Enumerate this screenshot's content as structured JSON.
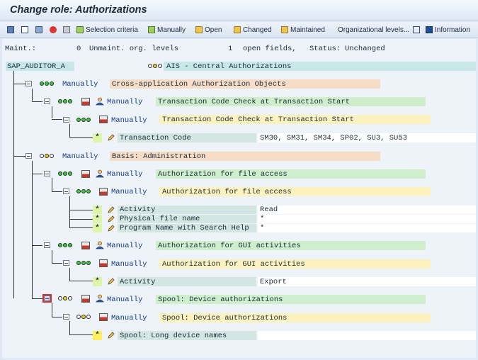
{
  "window": {
    "title": "Change role: Authorizations"
  },
  "toolbar": {
    "selection_criteria": "Selection criteria",
    "manually": "Manually",
    "open": "Open",
    "changed": "Changed",
    "maintained": "Maintained",
    "org_levels": "Organizational levels...",
    "information": "Information"
  },
  "status": {
    "maint_label": "Maint.:",
    "unmaint_count": "0",
    "unmaint_label": "Unmaint. org. levels",
    "open_count": "1",
    "open_label": "open fields,",
    "status_label": "Status:",
    "status_value": "Unchanged"
  },
  "tree": {
    "role": "SAP_AUDITOR_A",
    "role_desc": "AIS - Central Authorizations",
    "manually": "Manually",
    "class1": "Cross-application Authorization Objects",
    "obj1": "Transaction Code Check at Transaction Start",
    "auth1": "Transaction Code Check at Transaction Start",
    "f_tcode": "Transaction Code",
    "v_tcode": "SM30, SM31, SM34, SP02, SU3, SU53",
    "class2": "Basis: Administration",
    "obj2": "Authorization for file access",
    "auth2": "Authorization for file access",
    "f_activity": "Activity",
    "v_activity": "Read",
    "f_physical": "Physical file name",
    "v_physical": "*",
    "f_program": "Program Name with Search Help",
    "v_program": "*",
    "obj3": "Authorization for GUI activities",
    "auth3": "Authorization for GUI activities",
    "f_activity2": "Activity",
    "v_activity2": "Export",
    "obj4": "Spool: Device authorizations",
    "auth4": "Spool: Device authorizations",
    "f_spool": "Spool: Long device names",
    "v_spool": "",
    "star": "*"
  },
  "colors": {
    "title_bg": "#dde7f3",
    "role_bg": "#c8e8e8",
    "class_bg": "#f7dcc6",
    "object_bg": "#cfeecb",
    "auth_bg": "#fbf2c0",
    "field_bg": "#d3e6e1",
    "open_field_flag": "#ffef5c"
  }
}
